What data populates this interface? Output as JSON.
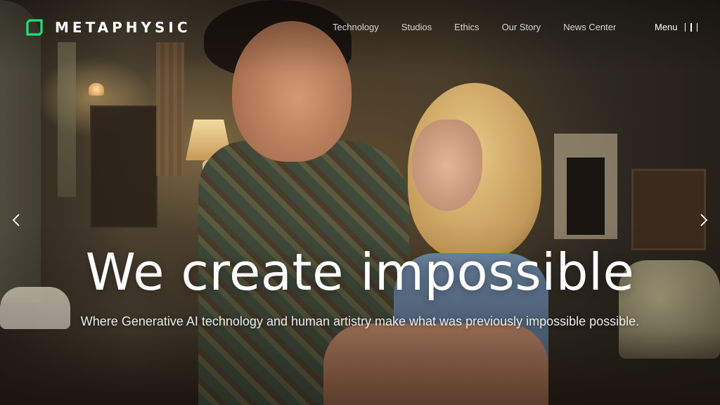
{
  "brand": {
    "name": "METAPHYSIC",
    "accent_color": "#21e07a",
    "logo_icon": "square-outline-logo-icon"
  },
  "nav": {
    "items": [
      {
        "label": "Technology"
      },
      {
        "label": "Studios"
      },
      {
        "label": "Ethics"
      },
      {
        "label": "Our Story"
      },
      {
        "label": "News Center"
      }
    ],
    "menu_label": "Menu",
    "menu_icon": "three-bar-menu-icon"
  },
  "hero": {
    "title": "We create impossible",
    "subtitle": "Where Generative AI technology and human artistry make what was previously impossible possible.",
    "prev_icon": "chevron-left-icon",
    "next_icon": "chevron-right-icon"
  }
}
